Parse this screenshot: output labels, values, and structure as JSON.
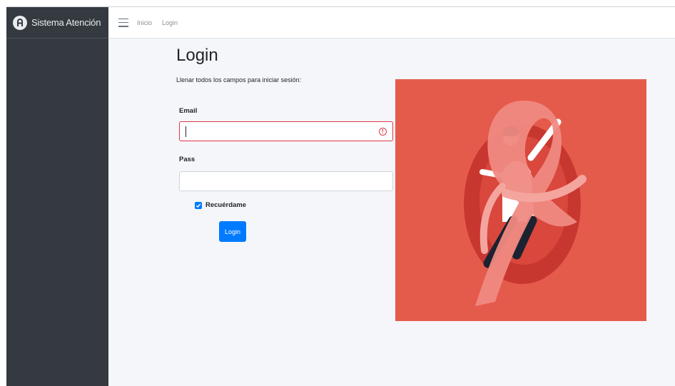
{
  "brand": {
    "name": "Sistema Atención"
  },
  "topnav": {
    "links": [
      "Inicio",
      "Login"
    ]
  },
  "login": {
    "title": "Login",
    "subtitle": "Llenar todos los campos para iniciar sesión:",
    "email_label": "Email",
    "email_value": "",
    "pass_label": "Pass",
    "pass_value": "",
    "remember_label": "Recuérdame",
    "remember_checked": true,
    "submit_label": "Login"
  },
  "colors": {
    "sidebar": "#343a40",
    "primary": "#007bff",
    "error": "#dc3545",
    "illustration_bg": "#e55b4b",
    "ribbon": "#f08a82"
  },
  "icons": [
    "brand-logo-icon",
    "hamburger-menu-icon",
    "error-icon",
    "check-icon"
  ]
}
